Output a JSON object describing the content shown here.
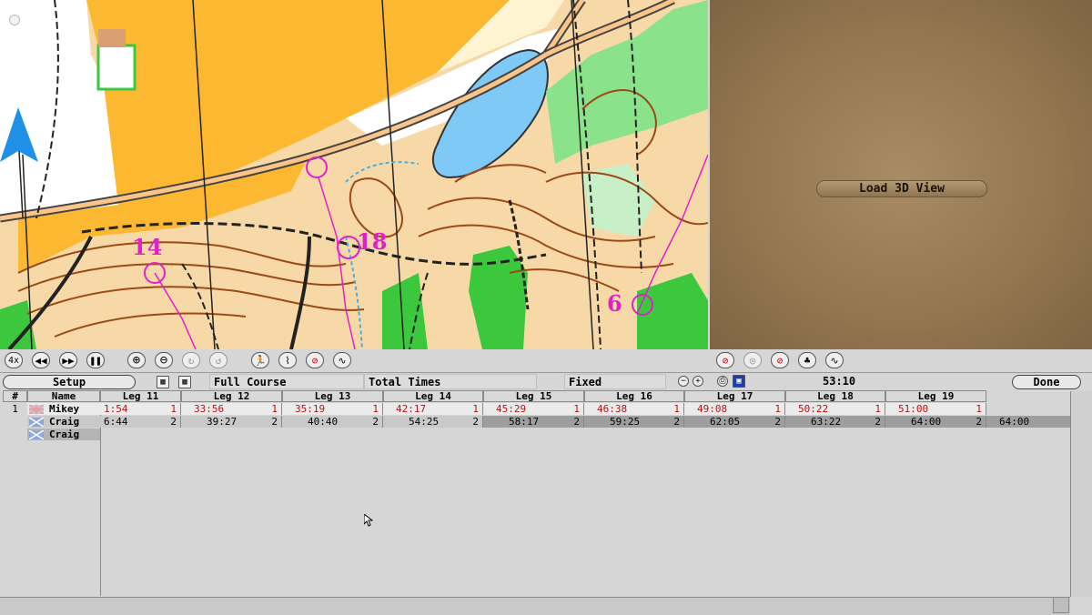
{
  "map": {
    "control_labels": [
      "14",
      "18",
      "6"
    ],
    "compass_icon": "north-arrow-icon"
  },
  "view3d": {
    "load_button": "Load 3D View"
  },
  "map_toolbar": {
    "speed_label": "4x",
    "buttons": [
      "rewind-icon",
      "fast-forward-icon",
      "pause-icon",
      "zoom-in-icon",
      "zoom-out-icon",
      "rotate-clockwise-icon",
      "rotate-counterclockwise-icon",
      "runner-icon",
      "route-icon",
      "no-route-icon",
      "tail-icon"
    ]
  },
  "view3d_toolbar": {
    "buttons": [
      "no-runner-icon",
      "camera-icon",
      "no-route-icon",
      "tree-icon",
      "tail-icon"
    ]
  },
  "controls": {
    "setup": "Setup",
    "course": "Full Course",
    "times": "Total Times",
    "mode": "Fixed",
    "clock": "53:10",
    "done": "Done"
  },
  "table": {
    "headers": {
      "num": "#",
      "name": "Name",
      "legs": [
        "Leg 11",
        "Leg 12",
        "Leg 13",
        "Leg 14",
        "Leg 15",
        "Leg 16",
        "Leg 17",
        "Leg 18",
        "Leg 19"
      ]
    },
    "rows": [
      {
        "num": "1",
        "name": "Mikey",
        "flag": "uk-flag-icon",
        "times": [
          "1:54",
          "33:56",
          "35:19",
          "42:17",
          "45:29",
          "46:38",
          "49:08",
          "50:22",
          "51:00"
        ],
        "places": [
          "1",
          "1",
          "1",
          "1",
          "1",
          "1",
          "1",
          "1",
          "1"
        ]
      },
      {
        "num": "",
        "name": "Craig",
        "flag": "scotland-flag-icon",
        "times": [
          "6:44",
          "39:27",
          "40:40",
          "54:25",
          "58:17",
          "59:25",
          "62:05",
          "63:22",
          "64:00"
        ],
        "places": [
          "2",
          "2",
          "2",
          "2",
          "2",
          "2",
          "2",
          "2",
          "2"
        ],
        "finish": "64:00"
      },
      {
        "num": "",
        "name": "Craig",
        "flag": "scotland-flag-icon"
      }
    ]
  },
  "colors": {
    "course": "#e020c8",
    "split_lead": "#b51414",
    "water": "#7ec9f5",
    "forest_green": "#3cc83c"
  }
}
